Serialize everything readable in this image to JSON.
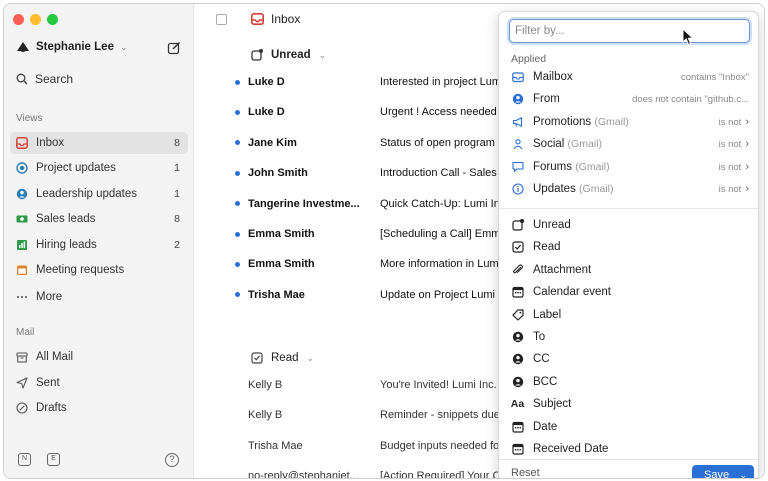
{
  "sidebar": {
    "user_name": "Stephanie Lee",
    "search_label": "Search",
    "views_label": "Views",
    "views": [
      {
        "label": "Inbox",
        "count": "8",
        "icon": "inbox-icon",
        "color": "#d9403a"
      },
      {
        "label": "Project updates",
        "count": "1",
        "icon": "target-icon",
        "color": "#2a7fb8"
      },
      {
        "label": "Leadership updates",
        "count": "1",
        "icon": "person-icon",
        "color": "#2a7fb8"
      },
      {
        "label": "Sales leads",
        "count": "8",
        "icon": "money-icon",
        "color": "#2e9a4a"
      },
      {
        "label": "Hiring leads",
        "count": "2",
        "icon": "chart-icon",
        "color": "#2e9a4a"
      },
      {
        "label": "Meeting requests",
        "count": "",
        "icon": "calendar-icon",
        "color": "#e0832f"
      },
      {
        "label": "More",
        "count": "",
        "icon": "ellipsis-icon",
        "color": "#666666"
      }
    ],
    "mail_label": "Mail",
    "mail": [
      {
        "label": "All Mail",
        "icon": "archive-icon"
      },
      {
        "label": "Sent",
        "icon": "send-icon"
      },
      {
        "label": "Drafts",
        "icon": "draft-icon"
      }
    ],
    "help_label": "?",
    "bottom_icon_1": "N",
    "bottom_icon_2": "E"
  },
  "main": {
    "title": "Inbox",
    "unread_group": "Unread",
    "read_group": "Read",
    "unread_rows": [
      {
        "sender": "Luke D",
        "subject": "Interested in project Lumi"
      },
      {
        "sender": "Luke D",
        "subject": "Urgent ! Access needed"
      },
      {
        "sender": "Jane Kim",
        "subject": "Status of open program"
      },
      {
        "sender": "John Smith",
        "subject": "Introduction Call - Sales"
      },
      {
        "sender": "Tangerine Investme...",
        "subject": "Quick Catch-Up: Lumi In"
      },
      {
        "sender": "Emma Smith",
        "subject": "[Scheduling a Call] Emm"
      },
      {
        "sender": "Emma Smith",
        "subject": "More information in Lumi"
      },
      {
        "sender": "Trisha Mae",
        "subject": "Update on Project Lumi"
      }
    ],
    "read_rows": [
      {
        "sender": "Kelly B",
        "subject": "You're Invited! Lumi Inc. E"
      },
      {
        "sender": "Kelly B",
        "subject": "Reminder - snippets due"
      },
      {
        "sender": "Trisha Mae",
        "subject": "Budget inputs needed for"
      },
      {
        "sender": "no-reply@stephaniet...",
        "subject": "[Action Required] Your C"
      }
    ]
  },
  "filter": {
    "placeholder": "Filter by...",
    "applied_label": "Applied",
    "applied": [
      {
        "label": "Mailbox",
        "gmail": "",
        "condition": "contains \"Inbox\"",
        "arrow": "",
        "icon": "mailbox-icon"
      },
      {
        "label": "From",
        "gmail": "",
        "condition": "does not contain \"github.c...",
        "arrow": "",
        "icon": "person-circle-icon"
      },
      {
        "label": "Promotions",
        "gmail": "(Gmail)",
        "condition": "is not",
        "arrow": "›",
        "icon": "megaphone-icon"
      },
      {
        "label": "Social",
        "gmail": "(Gmail)",
        "condition": "is not",
        "arrow": "›",
        "icon": "people-icon"
      },
      {
        "label": "Forums",
        "gmail": "(Gmail)",
        "condition": "is not",
        "arrow": "›",
        "icon": "chat-icon"
      },
      {
        "label": "Updates",
        "gmail": "(Gmail)",
        "condition": "is not",
        "arrow": "›",
        "icon": "info-icon"
      }
    ],
    "options": [
      {
        "label": "Unread",
        "icon": "unread-icon"
      },
      {
        "label": "Read",
        "icon": "check-square-icon"
      },
      {
        "label": "Attachment",
        "icon": "paperclip-icon"
      },
      {
        "label": "Calendar event",
        "icon": "calendar-event-icon"
      },
      {
        "label": "Label",
        "icon": "tag-icon"
      },
      {
        "label": "To",
        "icon": "to-icon"
      },
      {
        "label": "CC",
        "icon": "cc-icon"
      },
      {
        "label": "BCC",
        "icon": "bcc-icon"
      },
      {
        "label": "Subject",
        "icon": "subject-icon"
      },
      {
        "label": "Date",
        "icon": "date-icon"
      },
      {
        "label": "Received Date",
        "icon": "received-date-icon"
      }
    ],
    "subject_glyph": "Aa",
    "reset_label": "Reset",
    "save_label": "Save",
    "accent": "#2a6fd6"
  }
}
